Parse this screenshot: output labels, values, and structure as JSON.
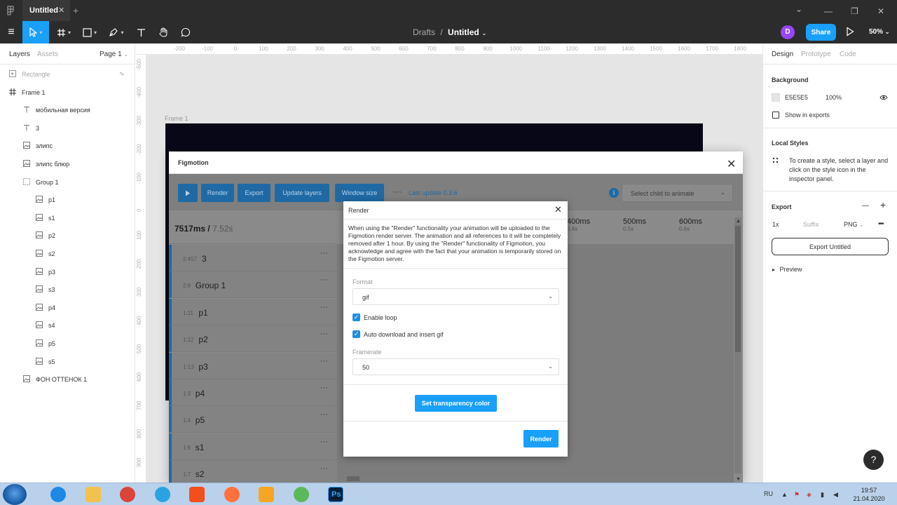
{
  "titlebar": {
    "tab_title": "Untitled",
    "close": "✕",
    "plus": "+",
    "minimize": "⌄",
    "restore": "—",
    "maximize": "❐",
    "close_window": "✕"
  },
  "toolbar": {
    "menu": "≡",
    "crumb_parent": "Drafts",
    "crumb_sep": "/",
    "crumb_file": "Untitled",
    "crumb_chev": "⌄",
    "avatar_letter": "D",
    "share_label": "Share",
    "zoom": "50%",
    "zoom_chev": "⌄"
  },
  "left_panel": {
    "tab_layers": "Layers",
    "tab_assets": "Assets",
    "page": "Page 1",
    "page_chev": "⌄",
    "layers": [
      {
        "name": "Rectangle",
        "icon": "play-box-icon",
        "muted": true
      },
      {
        "name": "Frame 1",
        "icon": "frame-icon",
        "bold": true
      },
      {
        "name": "мобильная версия",
        "icon": "text-icon"
      },
      {
        "name": "3",
        "icon": "text-icon"
      },
      {
        "name": "элипс",
        "icon": "image-icon"
      },
      {
        "name": "элипс блюр",
        "icon": "image-icon"
      },
      {
        "name": "Group 1",
        "icon": "group-icon"
      },
      {
        "name": "p1",
        "icon": "image-icon"
      },
      {
        "name": "s1",
        "icon": "image-icon"
      },
      {
        "name": "p2",
        "icon": "image-icon"
      },
      {
        "name": "s2",
        "icon": "image-icon"
      },
      {
        "name": "p3",
        "icon": "image-icon"
      },
      {
        "name": "s3",
        "icon": "image-icon"
      },
      {
        "name": "p4",
        "icon": "image-icon"
      },
      {
        "name": "s4",
        "icon": "image-icon"
      },
      {
        "name": "p5",
        "icon": "image-icon"
      },
      {
        "name": "s5",
        "icon": "image-icon"
      },
      {
        "name": "ФОН ОТТЕНОК 1",
        "icon": "image-icon"
      }
    ]
  },
  "rulers": {
    "top": [
      "-200",
      "-100",
      "0",
      "100",
      "200",
      "300",
      "400",
      "500",
      "600",
      "700",
      "800",
      "900",
      "1000",
      "1100",
      "1200",
      "1300",
      "1400",
      "1500",
      "1600",
      "1700",
      "1800"
    ],
    "left": [
      "-500",
      "-400",
      "-300",
      "-200",
      "-100",
      "0",
      "100",
      "200",
      "300",
      "400",
      "500",
      "600",
      "700",
      "800",
      "900"
    ]
  },
  "canvas": {
    "frame_label": "Frame 1"
  },
  "plugin": {
    "title": "Figmotion",
    "close": "✕",
    "buttons": [
      "Render",
      "Export",
      "Update layers",
      "Window size"
    ],
    "more": "···",
    "last_update": "Last update 0.3.6",
    "info": "i",
    "select_child": "Select child to animate",
    "select_chev": "⌄",
    "time_current": "7517ms",
    "time_sep": " / ",
    "time_total": "7.52s",
    "ticks": [
      {
        "ms": "400ms",
        "s": "0.4s"
      },
      {
        "ms": "500ms",
        "s": "0.5s"
      },
      {
        "ms": "600ms",
        "s": "0.6s"
      }
    ],
    "rows": [
      {
        "num": "2:457",
        "name": "3"
      },
      {
        "num": "2:8",
        "name": "Group 1"
      },
      {
        "num": "1:11",
        "name": "p1"
      },
      {
        "num": "1:12",
        "name": "p2"
      },
      {
        "num": "1:13",
        "name": "p3"
      },
      {
        "num": "1:3",
        "name": "p4"
      },
      {
        "num": "1:4",
        "name": "p5"
      },
      {
        "num": "1:6",
        "name": "s1"
      },
      {
        "num": "1:7",
        "name": "s2"
      }
    ],
    "row_more": "···"
  },
  "dialog": {
    "title": "Render",
    "close": "✕",
    "text": "When using the \"Render\" functionality your animation will be uploaded to the Figmotion render server. The animation and all references to it will be completely removed after 1 hour. By using the \"Render\" functionality of Figmotion, you acknowledge and agree with the fact that your animation is temporarily stored on the Figmotion server.",
    "format_label": "Format",
    "format_value": "gif",
    "enable_loop": "Enable loop",
    "auto_download": "Auto download and insert gif",
    "framerate_label": "Framerate",
    "framerate_value": "50",
    "chev": "⌄",
    "check": "✓",
    "transparency_label": "Set transparency color",
    "render_label": "Render"
  },
  "right_panel": {
    "tab_design": "Design",
    "tab_prototype": "Prototype",
    "tab_code": "Code",
    "background_title": "Background",
    "bg_hex": "E5E5E5",
    "bg_opacity": "100%",
    "show_in_exports": "Show in exports",
    "local_styles_title": "Local Styles",
    "local_styles_hint": "To create a style, select a layer and click on the style icon in the inspector panel.",
    "export_title": "Export",
    "minus": "—",
    "plus": "+",
    "export_scale": "1x",
    "export_suffix": "Suffix",
    "export_format": "PNG",
    "export_format_chev": "⌄",
    "export_more": "•••",
    "export_button": "Export Untitled",
    "preview": "Preview",
    "preview_arrow": "▸"
  },
  "help": "?",
  "taskbar": {
    "apps": [
      {
        "name": "ie",
        "color": "#1e88e5"
      },
      {
        "name": "explorer",
        "color": "#f2c14e"
      },
      {
        "name": "chrome",
        "color": "#db4437"
      },
      {
        "name": "telegram",
        "color": "#2aa3e0"
      },
      {
        "name": "figma",
        "color": "#f24e1e"
      },
      {
        "name": "firefox",
        "color": "#ff7139"
      },
      {
        "name": "media",
        "color": "#f6a623"
      },
      {
        "name": "utorrent",
        "color": "#5cb85c"
      },
      {
        "name": "photoshop",
        "color": "#001e36"
      }
    ],
    "ps_label": "Ps",
    "lang": "RU",
    "time": "19:57",
    "date": "21.04.2020"
  }
}
